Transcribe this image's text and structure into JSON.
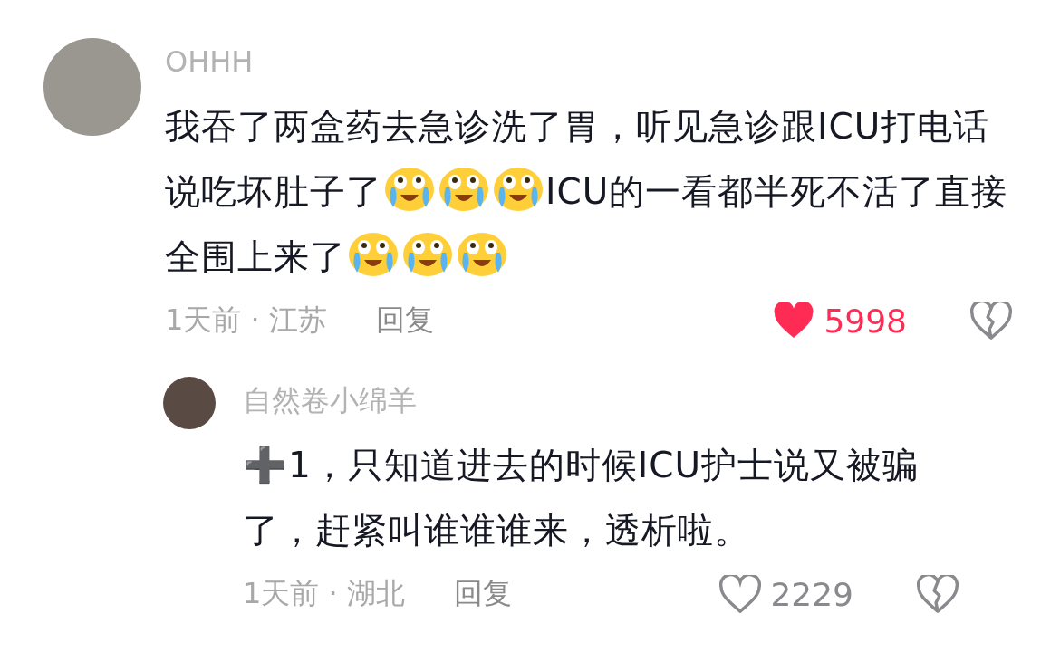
{
  "comments": [
    {
      "author": "OHHH",
      "body": [
        {
          "kind": "text",
          "text": "我吞了两盒药去急诊洗了胃，听见急诊跟ICU打电话说吃坏肚子了"
        },
        {
          "kind": "emoji"
        },
        {
          "kind": "emoji"
        },
        {
          "kind": "emoji"
        },
        {
          "kind": "text",
          "text": "ICU的一看都半死不活了直接全围上来了"
        },
        {
          "kind": "emoji"
        },
        {
          "kind": "emoji"
        },
        {
          "kind": "emoji"
        }
      ],
      "meta": "1天前 · 江苏",
      "reply": "回复",
      "liked": true,
      "likes": "5998",
      "replies": [
        {
          "author": "自然卷小绵羊",
          "body": [
            {
              "kind": "text",
              "text": "➕1，只知道进去的时候ICU护士说又被骗了，赶紧叫谁谁谁来，透析啦。"
            }
          ],
          "meta": "1天前 · 湖北",
          "reply": "回复",
          "liked": false,
          "likes": "2229"
        }
      ]
    }
  ]
}
